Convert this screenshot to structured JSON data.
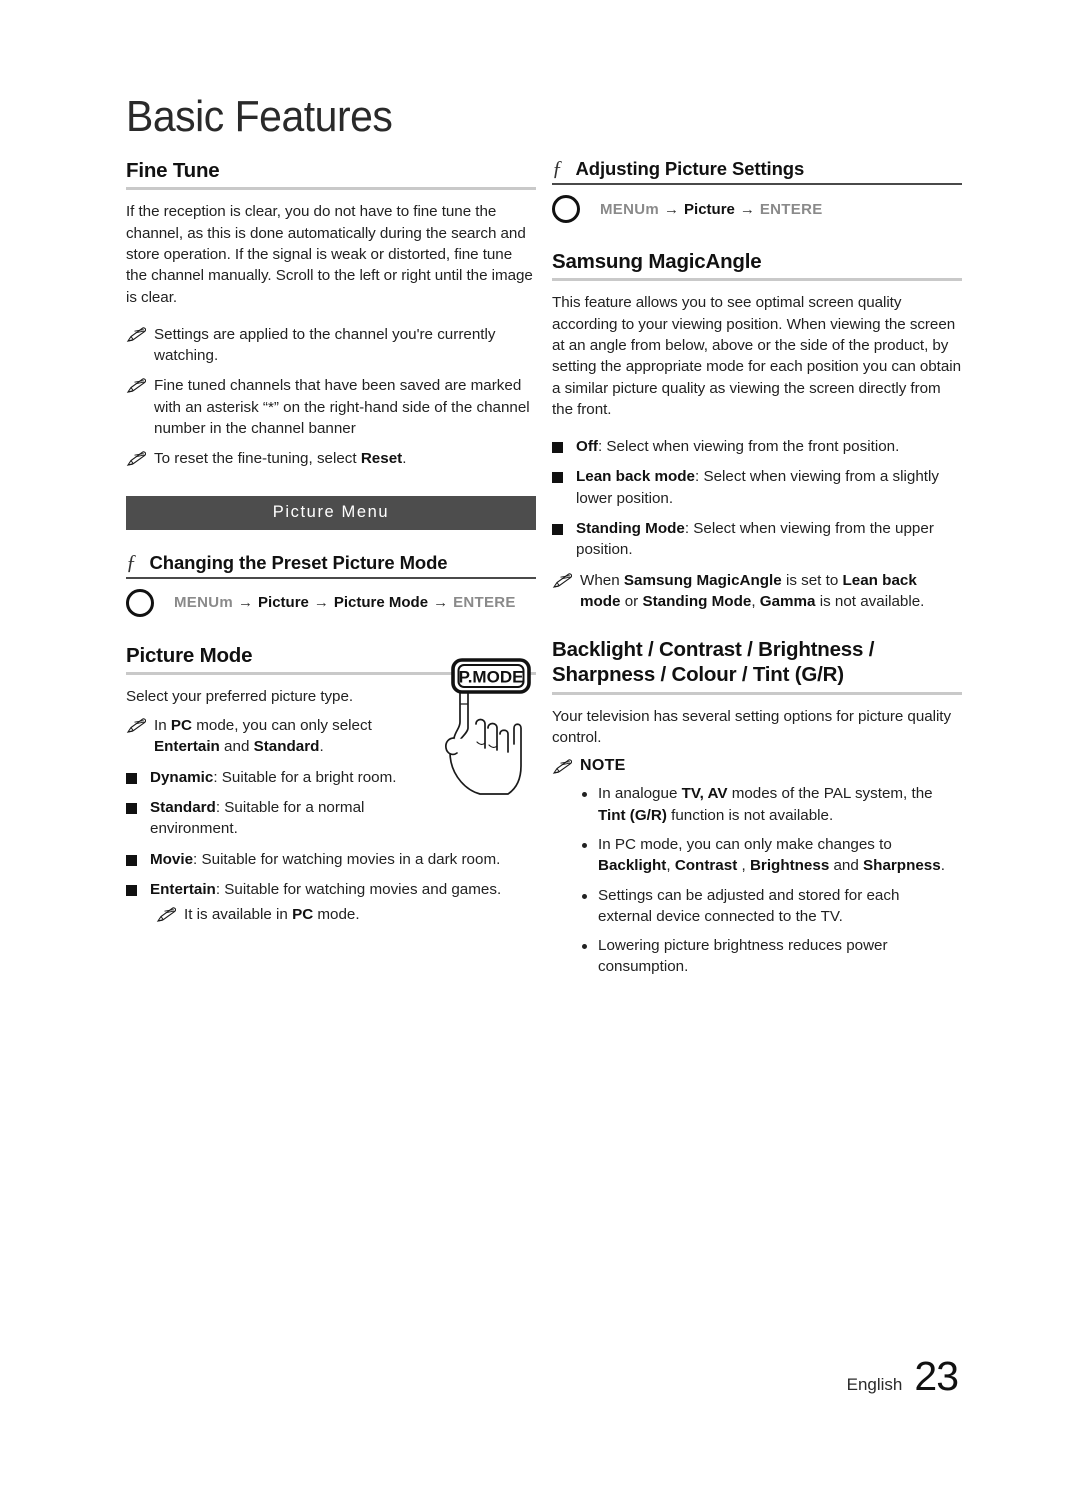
{
  "page": {
    "chapter_title": "Basic Features",
    "footer_language": "English",
    "footer_page_number": "23",
    "accent_bar_color": "#4d4d4d",
    "rule_light_color": "#c9c9c9",
    "rule_dark_color": "#4a4a4a"
  },
  "left_column": {
    "fine_tune": {
      "heading": "Fine Tune",
      "body": "If the reception is clear, you do not have to fine tune the channel, as this is done automatically during the search and store operation. If the signal is weak or distorted, fine tune the channel manually. Scroll to the left or right until the image is clear.",
      "notes": [
        "Settings are applied to the channel you're currently watching.",
        "Fine tuned channels that have been saved are marked with an asterisk “*” on the right-hand side of the channel number in the channel banner",
        "To reset the fine-tuning, select Reset."
      ],
      "note3_prefix": "To reset the fine-tuning, select ",
      "note3_bold": "Reset",
      "note3_suffix": "."
    },
    "section_bar_label": "Picture Menu",
    "changing_preset": {
      "fn_glyph": "ƒ",
      "heading": "Changing the Preset Picture Mode",
      "menu_path": {
        "start": "MENUm",
        "steps": [
          "Picture",
          "Picture Mode"
        ],
        "end": "ENTERE",
        "arrow": "→"
      }
    },
    "picture_mode": {
      "heading": "Picture Mode",
      "intro": "Select your preferred picture type.",
      "note_pc": {
        "part1": "In ",
        "bold1": "PC",
        "part2": " mode, you can only select ",
        "bold2": "Entertain",
        "part3": " and ",
        "bold3": "Standard",
        "part4": "."
      },
      "options": [
        {
          "name": "Dynamic",
          "desc": ": Suitable for a bright room."
        },
        {
          "name": "Standard",
          "desc": ": Suitable for a normal environment."
        },
        {
          "name": "Movie",
          "desc": ": Suitable for watching movies in a dark room."
        },
        {
          "name": "Entertain",
          "desc": ": Suitable for watching movies and games."
        }
      ],
      "sub_note": {
        "part1": "It is available in ",
        "bold1": "PC",
        "part2": " mode."
      },
      "button_graphic_label": "P.MODE"
    }
  },
  "right_column": {
    "adjusting": {
      "fn_glyph": "ƒ",
      "heading": "Adjusting Picture Settings",
      "menu_path": {
        "start": "MENUm",
        "steps": [
          "Picture"
        ],
        "end": "ENTERE",
        "arrow": "→"
      }
    },
    "magic_angle": {
      "heading": "Samsung MagicAngle",
      "body": "This feature allows you to see optimal screen quality according to your viewing position. When viewing the screen at an angle from below, above or the side of the product, by setting the appropriate mode for each position you can obtain a similar picture quality as viewing the screen directly from the front.",
      "options": [
        {
          "name": "Off",
          "desc": ": Select when viewing from the front position."
        },
        {
          "name": "Lean back mode",
          "desc": ": Select when viewing from a slightly lower position."
        },
        {
          "name": "Standing Mode",
          "desc": ": Select when viewing from the upper position."
        }
      ],
      "note": {
        "part1": "When ",
        "bold1": "Samsung MagicAngle",
        "part2": " is set to ",
        "bold2": "Lean back mode",
        "part3": " or ",
        "bold3": "Standing Mode",
        "part4": ", ",
        "bold4": "Gamma",
        "part5": " is not available."
      }
    },
    "backlight": {
      "heading_line1": "Backlight / Contrast / Brightness /",
      "heading_line2": "Sharpness / Colour / Tint (G/R)",
      "body": "Your television has several setting options for picture quality control.",
      "note_label": "NOTE",
      "bullets": [
        {
          "part1": "In analogue ",
          "bold1": "TV, AV",
          "part2": " modes of the PAL system, the ",
          "bold2": "Tint (G/R)",
          "part3": " function is not available."
        },
        {
          "part1": "In PC mode, you can only make changes to ",
          "bold1": "Backlight",
          "part2": ", ",
          "bold2": "Contrast",
          "part3": " , ",
          "bold3": "Brightness",
          "part4": " and ",
          "bold4": "Sharpness",
          "part5": "."
        },
        {
          "part1": "Settings can be adjusted and stored for each external device connected to the TV."
        },
        {
          "part1": "Lowering picture brightness reduces power consumption."
        }
      ]
    }
  }
}
